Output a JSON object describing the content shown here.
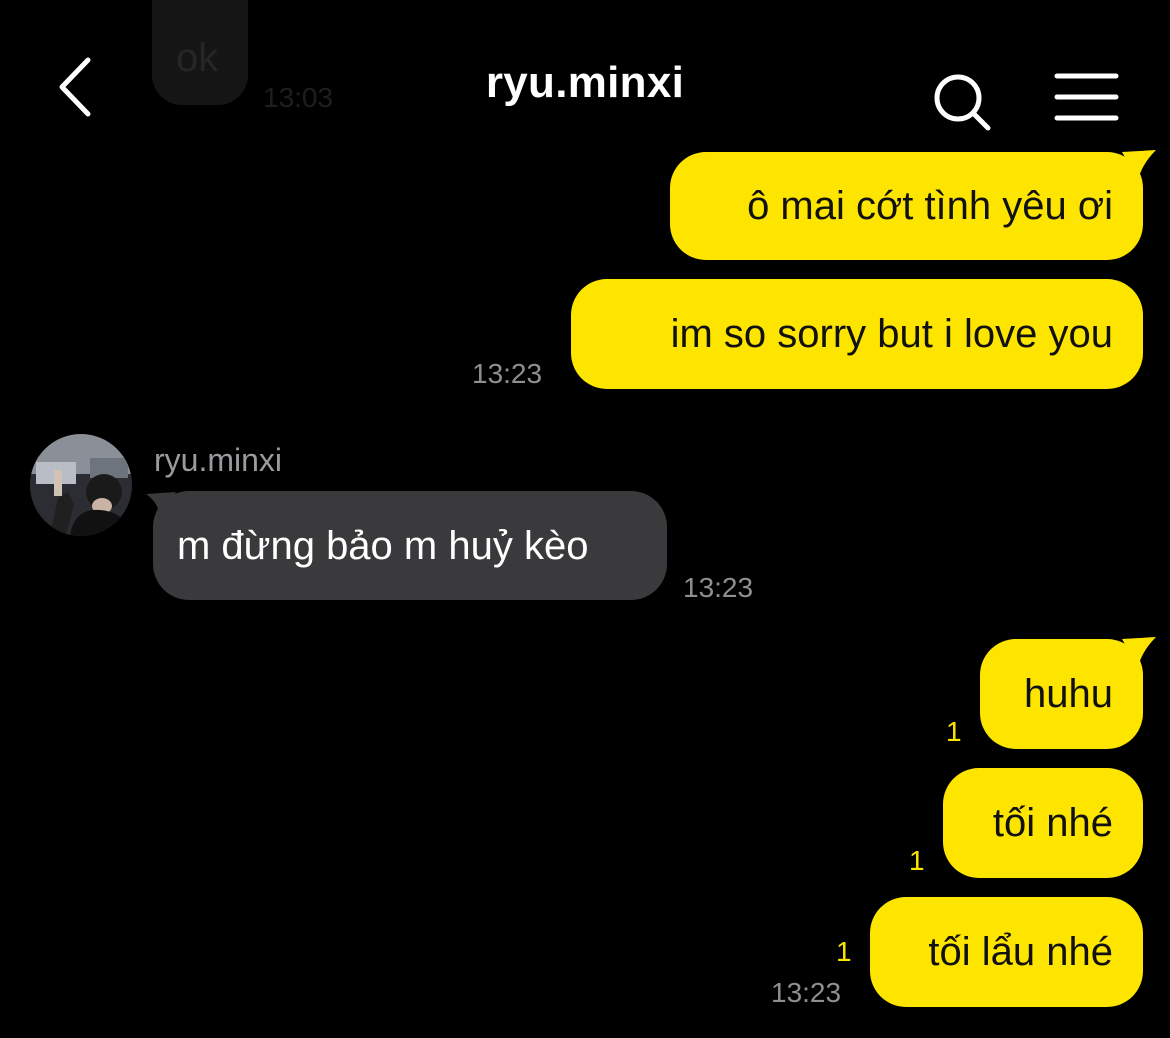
{
  "header": {
    "title": "ryu.minxi",
    "icons": {
      "back": "chevron-left-icon",
      "search": "search-icon",
      "menu": "hamburger-menu-icon"
    }
  },
  "previous_message": {
    "text": "ok",
    "time": "13:03"
  },
  "colors": {
    "my_bubble": "#FEE500",
    "their_bubble": "#3a3a3c",
    "background": "#000000",
    "timestamp": "#8e8e93",
    "unread_count": "#FEE500"
  },
  "contact": {
    "name": "ryu.minxi",
    "avatar_icon": "avatar-photo"
  },
  "messages": [
    {
      "from": "me",
      "text": "ô mai cớt tình yêu ơi"
    },
    {
      "from": "me",
      "text": "im so sorry but i love you",
      "time": "13:23"
    },
    {
      "from": "them",
      "text": "m đừng bảo m huỷ kèo",
      "time": "13:23"
    },
    {
      "from": "me",
      "text": "huhu",
      "unread": "1"
    },
    {
      "from": "me",
      "text": "tối nhé",
      "unread": "1"
    },
    {
      "from": "me",
      "text": "tối lẩu nhé",
      "unread": "1",
      "time": "13:23"
    }
  ]
}
